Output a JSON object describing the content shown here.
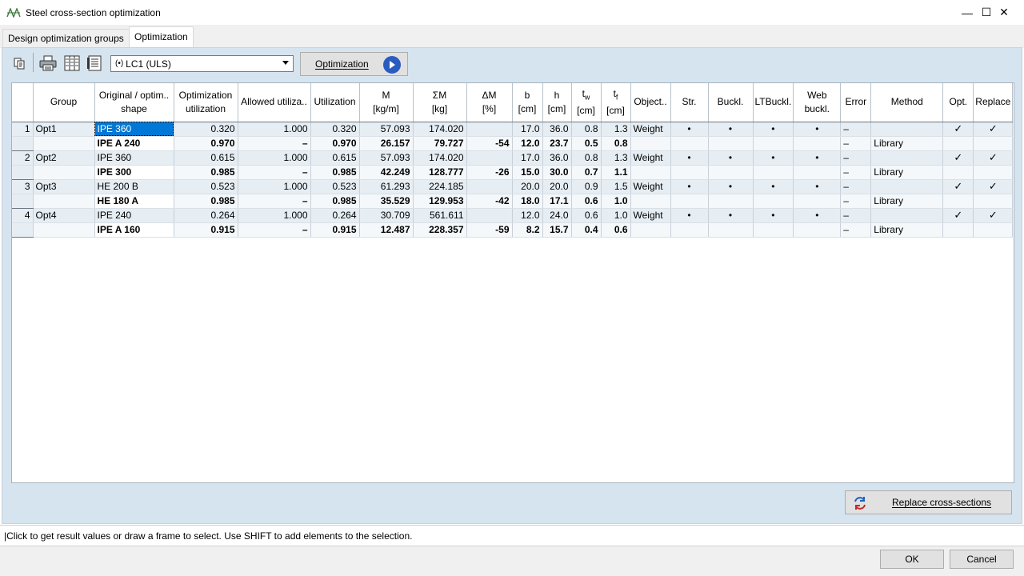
{
  "window": {
    "title": "Steel cross-section optimization",
    "minimize_glyph": "—",
    "maximize_glyph": "☐",
    "close_glyph": "✕"
  },
  "tabs": [
    {
      "label": "Design optimization groups",
      "active": false
    },
    {
      "label": "Optimization",
      "active": true
    }
  ],
  "toolbar": {
    "loadcase": {
      "prefix": "(•)",
      "value": "LC1 (ULS)"
    },
    "optimization_button": "Optimization"
  },
  "table": {
    "headers": {
      "group": "Group",
      "shape": [
        "Original / optim..",
        "shape"
      ],
      "opt_util": [
        "Optimization",
        "utilization"
      ],
      "allowed": "Allowed utiliza..",
      "util": "Utilization",
      "m": [
        "M",
        "[kg/m]"
      ],
      "sm": [
        "ΣM",
        "[kg]"
      ],
      "dm": [
        "ΔM",
        "[%]"
      ],
      "b": [
        "b",
        "[cm]"
      ],
      "h": [
        "h",
        "[cm]"
      ],
      "tw": [
        "t",
        "w",
        "[cm]"
      ],
      "tf": [
        "t",
        "f",
        "[cm]"
      ],
      "obj": "Object..",
      "str": "Str.",
      "buckl": "Buckl.",
      "ltb": "LTBuckl.",
      "web": [
        "Web",
        "buckl."
      ],
      "error": "Error",
      "method": "Method",
      "opt": "Opt.",
      "replace": "Replace"
    },
    "rows": [
      {
        "type": "orig",
        "num": "1",
        "group": "Opt1",
        "shape": "IPE 360",
        "opt_util": "0.320",
        "allowed": "1.000",
        "util": "0.320",
        "m": "57.093",
        "sm": "174.020",
        "dm": "",
        "b": "17.0",
        "h": "36.0",
        "tw": "0.8",
        "tf": "1.3",
        "obj": "Weight",
        "str": "•",
        "buckl": "•",
        "ltb": "•",
        "web": "•",
        "error": "–",
        "method": "",
        "opt": "✓",
        "replace": "✓"
      },
      {
        "type": "opt",
        "num": "",
        "group": "",
        "shape": "IPE A 240",
        "opt_util": "0.970",
        "allowed": "–",
        "util": "0.970",
        "m": "26.157",
        "sm": "79.727",
        "dm": "-54",
        "b": "12.0",
        "h": "23.7",
        "tw": "0.5",
        "tf": "0.8",
        "obj": "",
        "str": "",
        "buckl": "",
        "ltb": "",
        "web": "",
        "error": "–",
        "method": "Library",
        "opt": "",
        "replace": ""
      },
      {
        "type": "orig",
        "num": "2",
        "group": "Opt2",
        "shape": "IPE 360",
        "opt_util": "0.615",
        "allowed": "1.000",
        "util": "0.615",
        "m": "57.093",
        "sm": "174.020",
        "dm": "",
        "b": "17.0",
        "h": "36.0",
        "tw": "0.8",
        "tf": "1.3",
        "obj": "Weight",
        "str": "•",
        "buckl": "•",
        "ltb": "•",
        "web": "•",
        "error": "–",
        "method": "",
        "opt": "✓",
        "replace": "✓"
      },
      {
        "type": "opt",
        "num": "",
        "group": "",
        "shape": "IPE 300",
        "opt_util": "0.985",
        "allowed": "–",
        "util": "0.985",
        "m": "42.249",
        "sm": "128.777",
        "dm": "-26",
        "b": "15.0",
        "h": "30.0",
        "tw": "0.7",
        "tf": "1.1",
        "obj": "",
        "str": "",
        "buckl": "",
        "ltb": "",
        "web": "",
        "error": "–",
        "method": "Library",
        "opt": "",
        "replace": ""
      },
      {
        "type": "orig",
        "num": "3",
        "group": "Opt3",
        "shape": "HE  200 B",
        "opt_util": "0.523",
        "allowed": "1.000",
        "util": "0.523",
        "m": "61.293",
        "sm": "224.185",
        "dm": "",
        "b": "20.0",
        "h": "20.0",
        "tw": "0.9",
        "tf": "1.5",
        "obj": "Weight",
        "str": "•",
        "buckl": "•",
        "ltb": "•",
        "web": "•",
        "error": "–",
        "method": "",
        "opt": "✓",
        "replace": "✓"
      },
      {
        "type": "opt",
        "num": "",
        "group": "",
        "shape": "HE  180 A",
        "opt_util": "0.985",
        "allowed": "–",
        "util": "0.985",
        "m": "35.529",
        "sm": "129.953",
        "dm": "-42",
        "b": "18.0",
        "h": "17.1",
        "tw": "0.6",
        "tf": "1.0",
        "obj": "",
        "str": "",
        "buckl": "",
        "ltb": "",
        "web": "",
        "error": "–",
        "method": "Library",
        "opt": "",
        "replace": ""
      },
      {
        "type": "orig",
        "num": "4",
        "group": "Opt4",
        "shape": "IPE 240",
        "opt_util": "0.264",
        "allowed": "1.000",
        "util": "0.264",
        "m": "30.709",
        "sm": "561.611",
        "dm": "",
        "b": "12.0",
        "h": "24.0",
        "tw": "0.6",
        "tf": "1.0",
        "obj": "Weight",
        "str": "•",
        "buckl": "•",
        "ltb": "•",
        "web": "•",
        "error": "–",
        "method": "",
        "opt": "✓",
        "replace": "✓"
      },
      {
        "type": "opt",
        "num": "",
        "group": "",
        "shape": "IPE A 160",
        "opt_util": "0.915",
        "allowed": "–",
        "util": "0.915",
        "m": "12.487",
        "sm": "228.357",
        "dm": "-59",
        "b": "8.2",
        "h": "15.7",
        "tw": "0.4",
        "tf": "0.6",
        "obj": "",
        "str": "",
        "buckl": "",
        "ltb": "",
        "web": "",
        "error": "–",
        "method": "Library",
        "opt": "",
        "replace": ""
      }
    ]
  },
  "replace_button": "Replace cross-sections",
  "status": "|Click to get result values or draw a frame to select. Use SHIFT to add elements to the selection.",
  "dialog": {
    "ok": "OK",
    "cancel": "Cancel"
  },
  "icons": [
    "app-icon",
    "copy-icon",
    "print-icon",
    "columns-icon",
    "table-settings-icon",
    "play-icon",
    "refresh-icon"
  ]
}
